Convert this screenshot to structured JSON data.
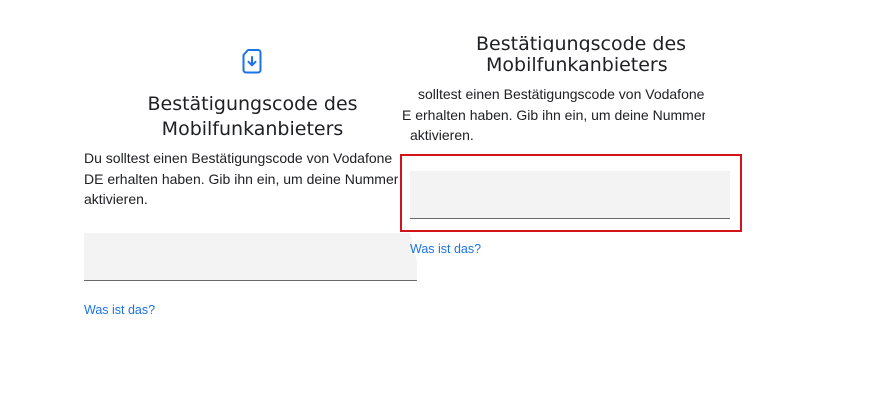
{
  "screen_left": {
    "icon": "sim-card-download-icon",
    "title_line1": "Bestätigungscode des",
    "title_line2": "Mobilfunkanbieters",
    "body_line1": "Du solltest einen Bestätigungscode von Vodafone",
    "body_line2": "DE erhalten haben. Gib ihn ein, um deine Nummer zu",
    "body_line3": "aktivieren.",
    "code_input_value": "",
    "help_link": "Was ist das?"
  },
  "screen_right": {
    "title_line1": "Bestätigungscode des",
    "title_line2": "Mobilfunkanbieters",
    "body_line1": "solltest einen Bestätigungscode von Vodafone",
    "body_line2": "E erhalten haben. Gib ihn ein, um deine Nummer zu",
    "body_line3": "aktivieren.",
    "code_input_value": "",
    "help_link": "Was ist das?"
  },
  "colors": {
    "link": "#1a73e8",
    "icon": "#1a73e8",
    "highlight": "#d3131a",
    "input_background": "#f3f3f3"
  }
}
